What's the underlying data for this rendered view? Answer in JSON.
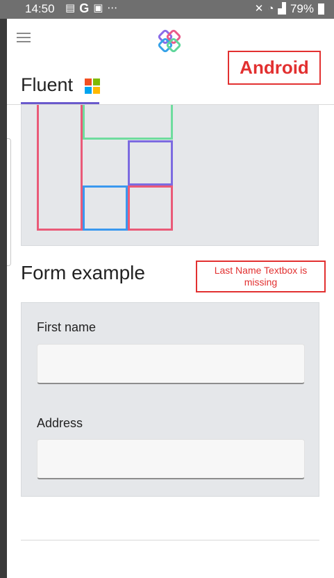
{
  "status_bar": {
    "time": "14:50",
    "battery": "79%",
    "left_icons": [
      "message-icon",
      "google-icon",
      "app-icon",
      "more-dots-icon"
    ],
    "right_icons": [
      "mute-icon",
      "wifi-icon",
      "signal-icon",
      "battery-icon"
    ]
  },
  "header": {
    "app_logo": "fluent-ui-logo",
    "tab_label": "Fluent",
    "tab_icon": "windows-logo-icon",
    "accent_color": "#6a5acd"
  },
  "annotations": {
    "platform": "Android",
    "note": "Last Name Textbox is missing",
    "color": "#e23030"
  },
  "layout_demo": {
    "colors": {
      "red": "#ea5a78",
      "green": "#6edc9e",
      "purple": "#7c6be0",
      "blue": "#3a98ef"
    }
  },
  "form": {
    "title": "Form example",
    "fields": [
      {
        "label": "First name",
        "value": "",
        "placeholder": ""
      },
      {
        "label": "Address",
        "value": "",
        "placeholder": ""
      }
    ]
  }
}
